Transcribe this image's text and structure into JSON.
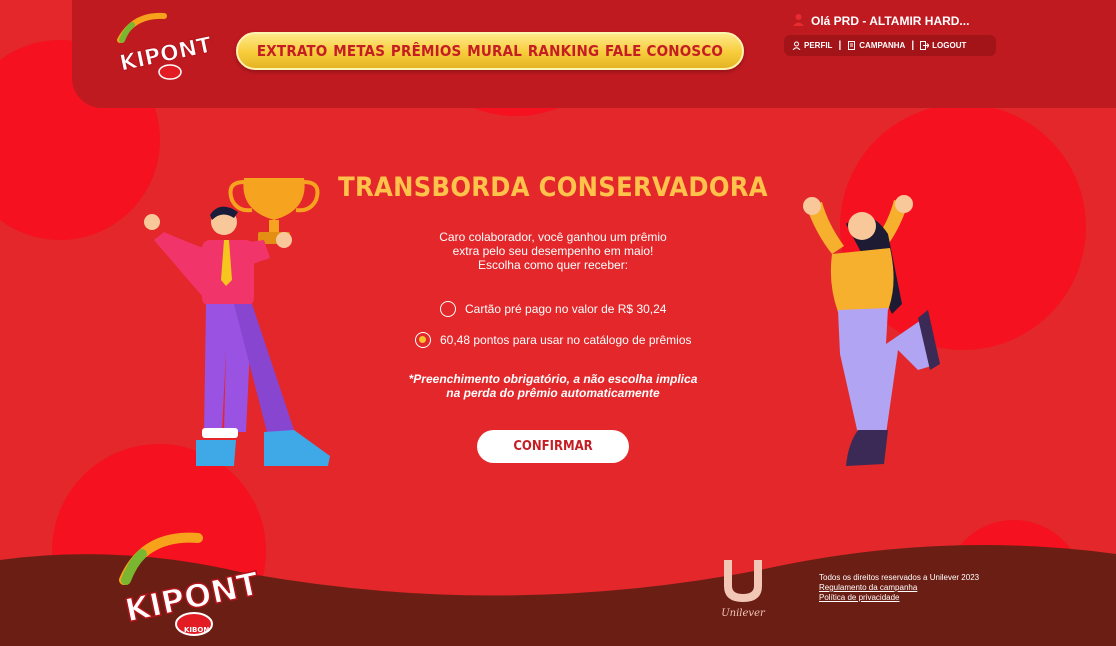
{
  "brand": {
    "logo_text": "KIPONTOS",
    "sub_brand": "KIBON"
  },
  "nav": {
    "items": [
      {
        "label": "EXTRATO"
      },
      {
        "label": "METAS"
      },
      {
        "label": "PRÊMIOS"
      },
      {
        "label": "MURAL"
      },
      {
        "label": "RANKING"
      },
      {
        "label": "FALE CONOSCO"
      }
    ]
  },
  "user": {
    "greeting": "Olá PRD - ALTAMIR HARD...",
    "menu": {
      "profile": "PERFIL",
      "campaign": "CAMPANHA",
      "logout": "LOGOUT"
    }
  },
  "main": {
    "title": "TRANSBORDA CONSERVADORA",
    "intro_line1": "Caro colaborador, você ganhou um prêmio",
    "intro_line2": "extra pelo seu desempenho em maio!",
    "intro_line3": "Escolha como quer receber:",
    "options": [
      {
        "label": "Cartão pré pago no valor de R$ 30,24",
        "selected": false
      },
      {
        "label": "60,48 pontos para usar no catálogo de prêmios",
        "selected": true
      }
    ],
    "note_line1": "*Preenchimento obrigatório, a não escolha implica",
    "note_line2": "na perda do prêmio automaticamente",
    "confirm_label": "CONFIRMAR"
  },
  "footer": {
    "unilever": "Unilever",
    "copyright": "Todos os direitos reservados a Unilever 2023",
    "regulation_link": "Regulamento da campanha",
    "privacy_link": "Política de privacidade"
  },
  "colors": {
    "background": "#e3272a",
    "header": "#c01a21",
    "accent_yellow": "#ffc24a",
    "nav_gold": "#f7cc3a",
    "footer_brown": "#6b1f14"
  }
}
